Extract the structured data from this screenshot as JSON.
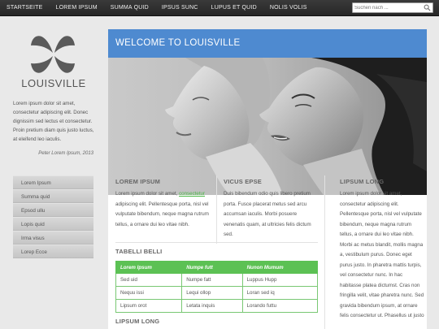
{
  "nav": {
    "items": [
      "Startseite",
      "Lorem Ipsum",
      "Summa Quid",
      "Ipsus Sunc",
      "Lupus et quid",
      "Nolis Volis"
    ],
    "search_placeholder": "Suchen nach ..."
  },
  "sidebar": {
    "brand": "LOUISVILLE",
    "intro": "Lorem ipsum dolor sit amet, consectetur adipiscing elit. Donec dignissim sed lectus et consectetur. Proin pretium diam quis justo luctus, at eleifend leo iaculis.",
    "quote": "Peter Lorem Ipsum, 2013",
    "menu": [
      "Lorem Ipsum",
      "Summa quid",
      "Epsod ullu",
      "Lopis quid",
      "Irma visus",
      "Lorep Ecce"
    ]
  },
  "main": {
    "welcome": "Welcome to Louisville",
    "col1": {
      "title": "Lorem Ipsum",
      "text_pre": "Lorem ipsum dolor sit amet, ",
      "link": "consectetur",
      "text_post": " adipiscing elit. Pellentesque porta, nisl vel vulputate bibendum, neque magna rutrum tellus, a ornare dui leo vitae nibh."
    },
    "col2": {
      "title": "Vicus Epse",
      "text": "Duis bibendum odio quis libero pretium porta. Fusce placerat metus sed arcu accumsan iaculis. Morbi posuere venenatis quam, at ultricies felis dictum sed."
    },
    "col3": {
      "title": "Lipsum long",
      "text": "Lorem ipsum dolor sit amet, consectetur adipiscing elit. Pellentesque porta, nisl vel vulputate bibendum, neque magna rutrum tellus, a ornare dui leo vitae nibh. Morbi ac metus blandit, mollis magna a, vestibulum purus. Donec eget purus justo. In pharetra mattis turpis, vel consectetur nunc. In hac habitasse platea dictumst. Cras non fringilla velit, vitae pharetra nunc. Sed gravida bibendum ipsum, at ornare felis consectetur ut. Phasellus ut justo"
    },
    "table_title": "Tabelli Belli",
    "table": {
      "headers": [
        "Lorem Ipsum",
        "Numpe futt",
        "Nunon Mumum"
      ],
      "rows": [
        [
          "Sed uid",
          "Numpe fatt",
          "Luppus Hupp"
        ],
        [
          "Nequu issi",
          "Lequi ollop",
          "Loran sed iq"
        ],
        [
          "Lipsum orot",
          "Letata inquis",
          "Lorando futtu"
        ]
      ]
    },
    "footer_title": "Lipsum long"
  },
  "colors": {
    "accent_blue": "#4e8ad0",
    "accent_green": "#5cc154",
    "topbar": "#2e2e2e"
  }
}
